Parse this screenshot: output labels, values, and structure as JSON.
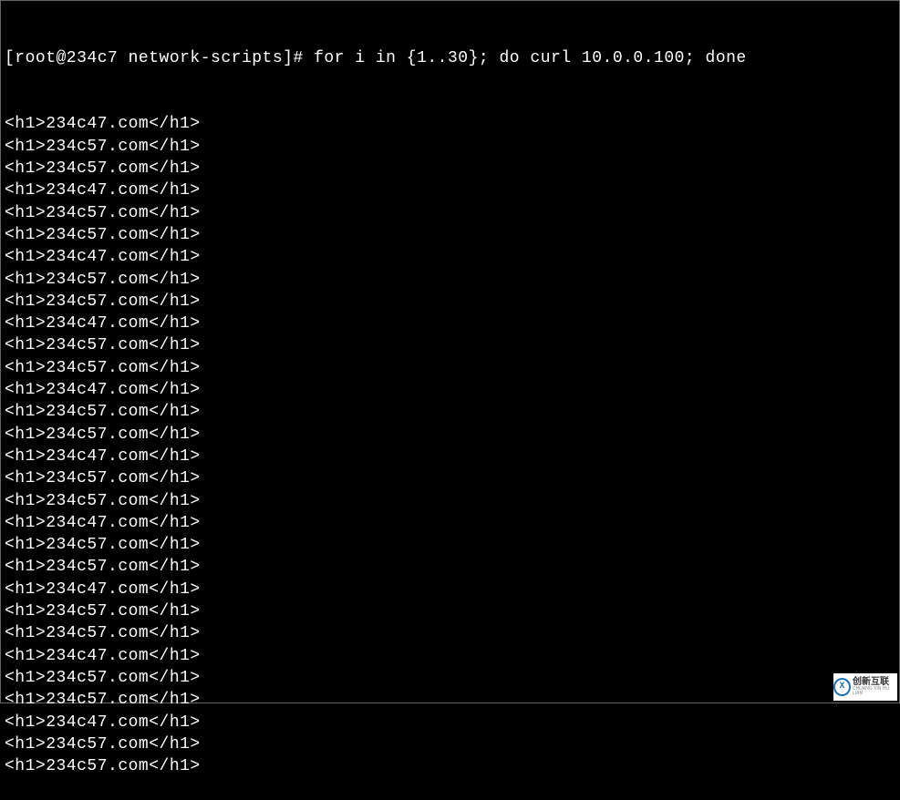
{
  "terminal": {
    "prompt": "[root@234c7 network-scripts]# ",
    "command": "for i in {1..30}; do curl 10.0.0.100; done",
    "output_lines": [
      "<h1>234c47.com</h1>",
      "<h1>234c57.com</h1>",
      "<h1>234c57.com</h1>",
      "<h1>234c47.com</h1>",
      "<h1>234c57.com</h1>",
      "<h1>234c57.com</h1>",
      "<h1>234c47.com</h1>",
      "<h1>234c57.com</h1>",
      "<h1>234c57.com</h1>",
      "<h1>234c47.com</h1>",
      "<h1>234c57.com</h1>",
      "<h1>234c57.com</h1>",
      "<h1>234c47.com</h1>",
      "<h1>234c57.com</h1>",
      "<h1>234c57.com</h1>",
      "<h1>234c47.com</h1>",
      "<h1>234c57.com</h1>",
      "<h1>234c57.com</h1>",
      "<h1>234c47.com</h1>",
      "<h1>234c57.com</h1>",
      "<h1>234c57.com</h1>",
      "<h1>234c47.com</h1>",
      "<h1>234c57.com</h1>",
      "<h1>234c57.com</h1>",
      "<h1>234c47.com</h1>",
      "<h1>234c57.com</h1>",
      "<h1>234c57.com</h1>",
      "<h1>234c47.com</h1>",
      "<h1>234c57.com</h1>",
      "<h1>234c57.com</h1>"
    ]
  },
  "watermark": {
    "icon_letter": "X",
    "cn": "创新互联",
    "en": "CHUANG XIN HU LIAN"
  }
}
